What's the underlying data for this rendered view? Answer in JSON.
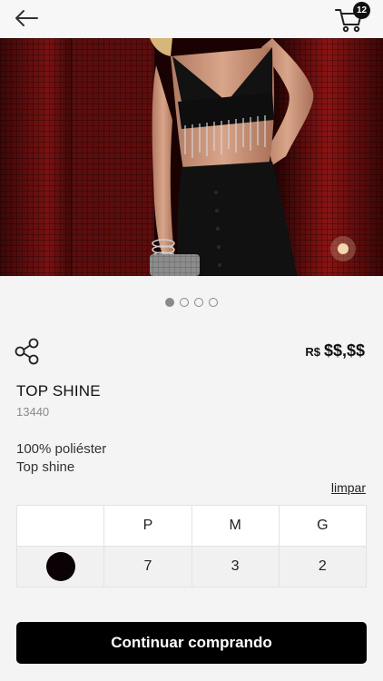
{
  "header": {
    "back_icon": "arrow-left-icon",
    "cart_icon": "shopping-cart-icon",
    "cart_count": "12"
  },
  "gallery": {
    "image_alt": "Model wearing black crop top with rhinestone fringe and black trousers against red-lit background",
    "dots": [
      {
        "active": true
      },
      {
        "active": false
      },
      {
        "active": false
      },
      {
        "active": false
      }
    ]
  },
  "product": {
    "share_icon": "share-icon",
    "currency": "R$",
    "price": "$$,$$",
    "name": "TOP SHINE",
    "sku": "13440",
    "description_line1": "100% poliéster",
    "description_line2": "Top shine"
  },
  "sizes": {
    "clear_label": "limpar",
    "headers": [
      "P",
      "M",
      "G"
    ],
    "color_hex": "#0b0206",
    "quantities": [
      "7",
      "3",
      "2"
    ]
  },
  "actions": {
    "continue_label": "Continuar comprando"
  }
}
